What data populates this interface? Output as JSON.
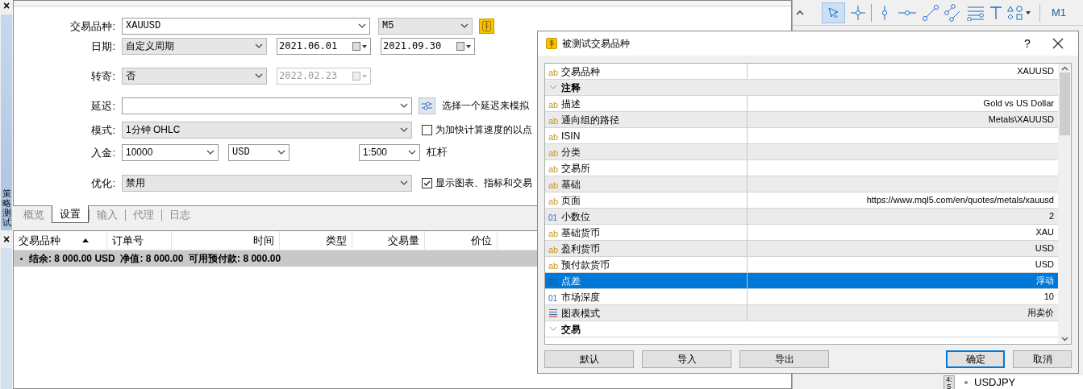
{
  "side_panel": {
    "close": "×",
    "title": "策略测试"
  },
  "settings": {
    "symbol": {
      "label": "交易品种:",
      "value": "XAUUSD",
      "timeframe": "M5"
    },
    "dates": {
      "label": "日期:",
      "period": "自定义周期",
      "from": "2021.06.01",
      "to": "2021.09.30"
    },
    "forward": {
      "label": "转寄:",
      "value": "否",
      "date": "2022.02.23",
      "disabled": true
    },
    "delay": {
      "label": "延迟:",
      "hint": "选择一个延迟来模拟"
    },
    "mode": {
      "label": "模式:",
      "value": "1分钟 OHLC",
      "option": "为加快计算速度的以点",
      "checked": false
    },
    "deposit": {
      "label": "入金:",
      "value": "10000",
      "currency": "USD",
      "leverage": "1:500",
      "leverage_label": "杠杆"
    },
    "optimization": {
      "label": "优化:",
      "value": "禁用",
      "option": "显示图表、指标和交易",
      "checked": true
    }
  },
  "tabs": [
    {
      "label": "概览",
      "selected": false
    },
    {
      "label": "设置",
      "selected": true
    },
    {
      "label": "输入",
      "selected": false
    },
    {
      "label": "代理",
      "selected": false
    },
    {
      "label": "日志",
      "selected": false
    }
  ],
  "table": {
    "close": "×",
    "columns": [
      {
        "label": "交易品种",
        "sorted": true
      },
      {
        "label": "订单号",
        "sorted": false
      },
      {
        "label": "时间",
        "sorted": false
      },
      {
        "label": "类型",
        "sorted": false
      },
      {
        "label": "交易量",
        "sorted": false
      },
      {
        "label": "价位",
        "sorted": false
      }
    ],
    "summary": "结余: 8 000.00 USD  净值: 8 000.00  可用预付款: 8 000.00"
  },
  "toolbar": {
    "timeframe": "M1"
  },
  "market_watch": {
    "symbol": "USDJPY",
    "time": "4:5"
  },
  "dialog": {
    "title": "被测试交易品种",
    "help": "?",
    "rows": [
      {
        "kind": "text",
        "icon": "ab",
        "name": "交易品种",
        "value": "XAUUSD",
        "selected": false
      },
      {
        "kind": "group",
        "name": "注释",
        "selected": false
      },
      {
        "kind": "text",
        "icon": "ab",
        "name": "描述",
        "value": "Gold vs US Dollar",
        "selected": false
      },
      {
        "kind": "text",
        "icon": "ab",
        "name": "通向组的路径",
        "value": "Metals\\XAUUSD",
        "selected": false
      },
      {
        "kind": "text",
        "icon": "ab",
        "name": "ISIN",
        "selected": false
      },
      {
        "kind": "text",
        "icon": "ab",
        "name": "分类",
        "selected": false
      },
      {
        "kind": "text",
        "icon": "ab",
        "name": "交易所",
        "selected": false
      },
      {
        "kind": "text",
        "icon": "ab",
        "name": "基础",
        "selected": false
      },
      {
        "kind": "text",
        "icon": "ab",
        "name": "页面",
        "value": "https://www.mql5.com/en/quotes/metals/xauusd",
        "selected": false
      },
      {
        "kind": "number",
        "icon": "01",
        "name": "小数位",
        "value": "2",
        "selected": false
      },
      {
        "kind": "text",
        "icon": "ab",
        "name": "基础货币",
        "value": "XAU",
        "selected": false
      },
      {
        "kind": "text",
        "icon": "ab",
        "name": "盈利货币",
        "value": "USD",
        "selected": false
      },
      {
        "kind": "text",
        "icon": "ab",
        "name": "预付款货币",
        "value": "USD",
        "selected": false
      },
      {
        "kind": "number",
        "icon": "01",
        "name": "点差",
        "value": "浮动",
        "selected": true
      },
      {
        "kind": "number",
        "icon": "01",
        "name": "市场深度",
        "value": "10",
        "selected": false
      },
      {
        "kind": "enum",
        "name": "图表模式",
        "value": "用卖价",
        "selected": false
      },
      {
        "kind": "group",
        "name": "交易",
        "selected": false
      }
    ],
    "buttons": [
      {
        "label": "默认",
        "kind": "left"
      },
      {
        "label": "导入",
        "kind": "left"
      },
      {
        "label": "导出",
        "kind": "left"
      },
      {
        "label": "确定",
        "kind": "default"
      },
      {
        "label": "取消",
        "kind": "right"
      }
    ]
  }
}
